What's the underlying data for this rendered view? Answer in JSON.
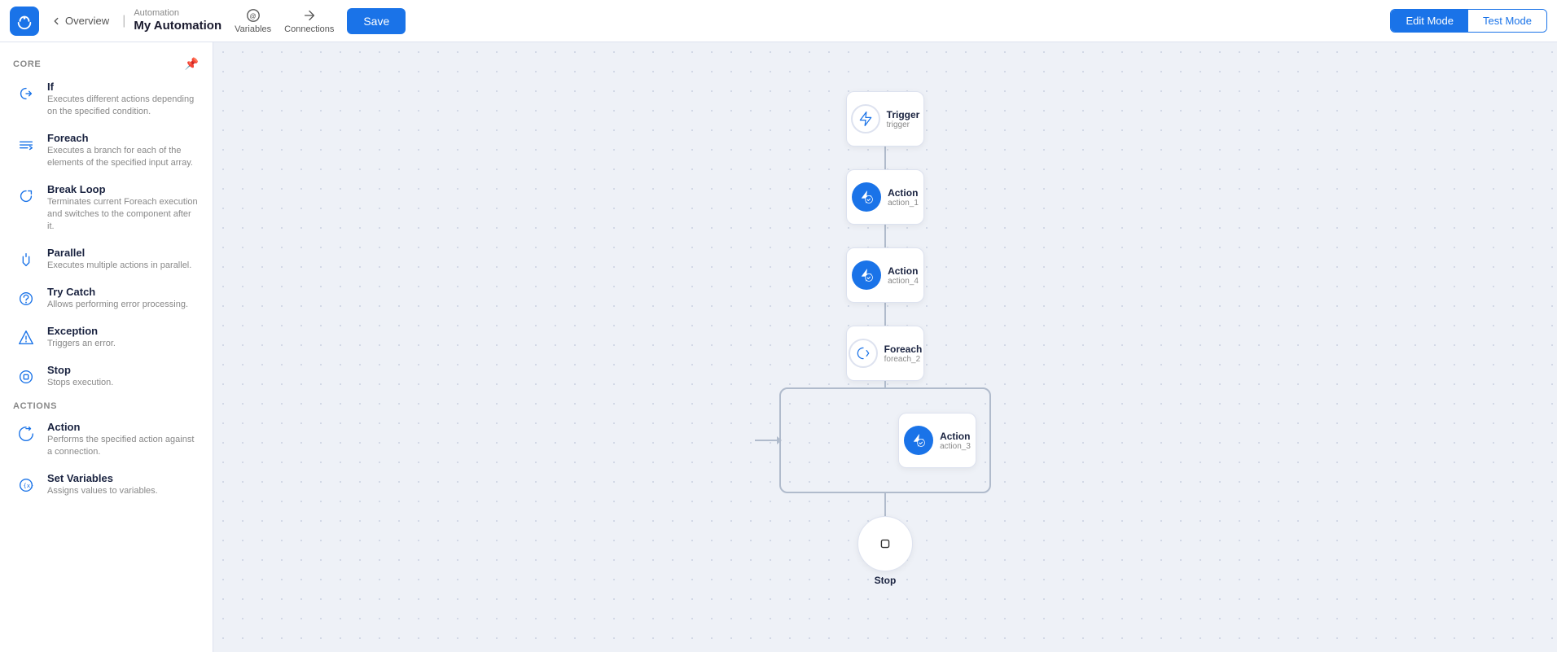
{
  "header": {
    "breadcrumb_top": "Automation",
    "breadcrumb_title": "My Automation",
    "back_label": "Overview",
    "variables_label": "Variables",
    "connections_label": "Connections",
    "save_label": "Save",
    "edit_mode_label": "Edit Mode",
    "test_mode_label": "Test Mode"
  },
  "sidebar": {
    "core_section": "CORE",
    "actions_section": "ACTIONS",
    "core_items": [
      {
        "name": "If",
        "desc": "Executes different actions depending on the specified condition.",
        "icon": "if"
      },
      {
        "name": "Foreach",
        "desc": "Executes a branch for each of the elements of the specified input array.",
        "icon": "foreach"
      },
      {
        "name": "Break Loop",
        "desc": "Terminates current Foreach execution and switches to the component after it.",
        "icon": "breakloop"
      },
      {
        "name": "Parallel",
        "desc": "Executes multiple actions in parallel.",
        "icon": "parallel"
      },
      {
        "name": "Try Catch",
        "desc": "Allows performing error processing.",
        "icon": "trycatch"
      },
      {
        "name": "Exception",
        "desc": "Triggers an error.",
        "icon": "exception"
      },
      {
        "name": "Stop",
        "desc": "Stops execution.",
        "icon": "stop"
      }
    ],
    "action_items": [
      {
        "name": "Action",
        "desc": "Performs the specified action against a connection.",
        "icon": "action"
      },
      {
        "name": "Set Variables",
        "desc": "Assigns values to variables.",
        "icon": "setvariables"
      }
    ]
  },
  "flow": {
    "nodes": [
      {
        "id": "trigger",
        "type": "trigger",
        "name": "Trigger",
        "subname": "trigger"
      },
      {
        "id": "action1",
        "type": "action",
        "name": "Action",
        "subname": "action_1"
      },
      {
        "id": "action4",
        "type": "action",
        "name": "Action",
        "subname": "action_4"
      },
      {
        "id": "foreach2",
        "type": "foreach",
        "name": "Foreach",
        "subname": "foreach_2"
      },
      {
        "id": "action3",
        "type": "action",
        "name": "Action",
        "subname": "action_3"
      },
      {
        "id": "stop",
        "type": "stop",
        "name": "Stop",
        "subname": ""
      }
    ]
  }
}
